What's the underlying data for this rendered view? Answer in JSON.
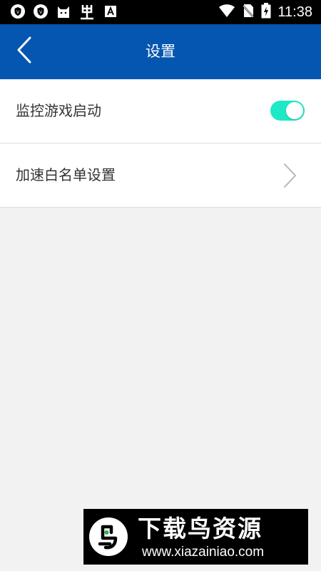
{
  "status_bar": {
    "time": "11:38",
    "left_icons": [
      "shield-icon",
      "shield-icon",
      "cat-icon",
      "bug-icon",
      "font-icon"
    ],
    "right_icons": [
      "wifi-icon",
      "no-sim-icon",
      "battery-charging-icon"
    ]
  },
  "header": {
    "title": "设置",
    "background": "#0556b0"
  },
  "settings": {
    "items": [
      {
        "label": "监控游戏启动",
        "control": "toggle",
        "checked": true
      },
      {
        "label": "加速白名单设置",
        "control": "chevron"
      }
    ],
    "toggle_color": "#1de9c6"
  },
  "watermark": {
    "title": "下载鸟资源",
    "url": "www.xiazainiao.com"
  }
}
